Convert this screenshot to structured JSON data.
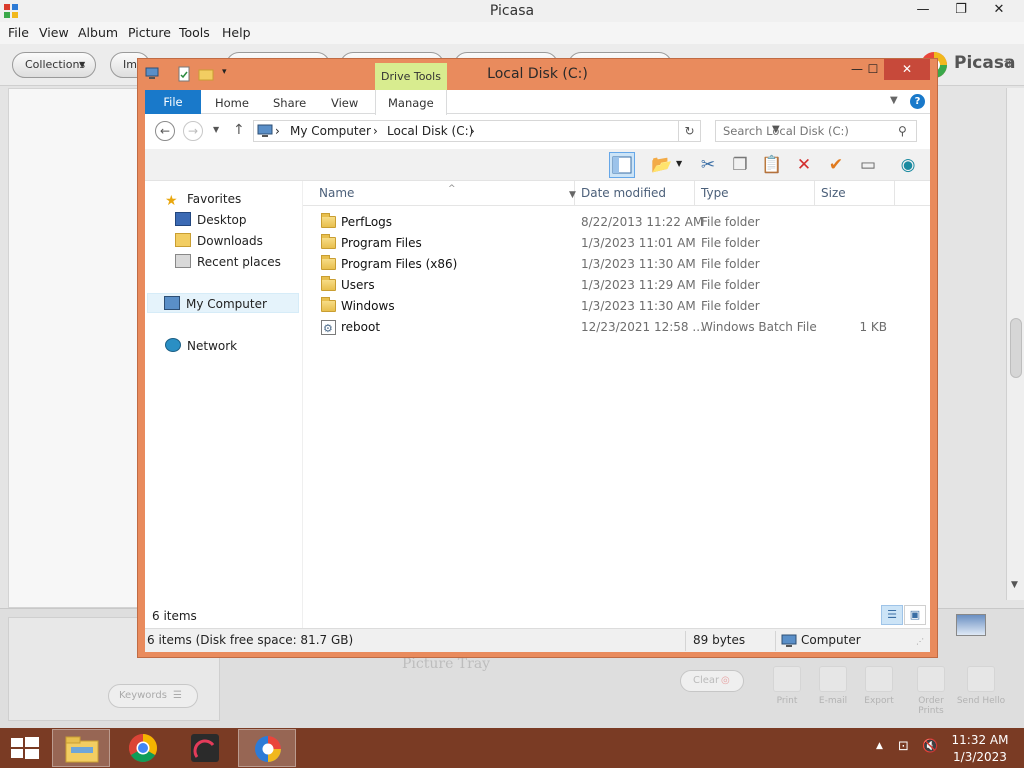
{
  "picasa": {
    "title": "Picasa",
    "menu": [
      "File",
      "View",
      "Album",
      "Picture",
      "Tools",
      "Help"
    ],
    "toolbar": {
      "collections_label": "Collections",
      "import_label": "Im"
    },
    "brand": {
      "name": "Picasa",
      "tm": "TM"
    },
    "window_controls": {
      "minimize": "—",
      "maximize": "❐",
      "close": "✕"
    },
    "bottom": {
      "keywords_label": "Keywords",
      "picture_tray_label": "Picture Tray",
      "clear_label": "Clear",
      "actions": [
        "Print",
        "E-mail",
        "Export",
        "Order Prints",
        "Send Hello"
      ]
    }
  },
  "explorer": {
    "title": "Local Disk (C:)",
    "context_tab": "Drive Tools",
    "window_controls": {
      "minimize": "—",
      "maximize": "☐",
      "close": "✕"
    },
    "ribbon_tabs": [
      "File",
      "Home",
      "Share",
      "View",
      "Manage"
    ],
    "help_label": "?",
    "address": {
      "segments": [
        "My Computer",
        "Local Disk (C:)"
      ],
      "separator": "›"
    },
    "search": {
      "placeholder": "Search Local Disk (C:)"
    },
    "navigation": {
      "favorites": "Favorites",
      "favorites_items": [
        "Desktop",
        "Downloads",
        "Recent places"
      ],
      "computer": "My Computer",
      "network": "Network"
    },
    "columns": [
      "Name",
      "Date modified",
      "Type",
      "Size"
    ],
    "files": [
      {
        "name": "PerfLogs",
        "date": "8/22/2013 11:22 AM",
        "type": "File folder",
        "size": "",
        "kind": "folder"
      },
      {
        "name": "Program Files",
        "date": "1/3/2023 11:01 AM",
        "type": "File folder",
        "size": "",
        "kind": "folder"
      },
      {
        "name": "Program Files (x86)",
        "date": "1/3/2023 11:30 AM",
        "type": "File folder",
        "size": "",
        "kind": "folder"
      },
      {
        "name": "Users",
        "date": "1/3/2023 11:29 AM",
        "type": "File folder",
        "size": "",
        "kind": "folder"
      },
      {
        "name": "Windows",
        "date": "1/3/2023 11:30 AM",
        "type": "File folder",
        "size": "",
        "kind": "folder"
      },
      {
        "name": "reboot",
        "date": "12/23/2021 12:58 ...",
        "type": "Windows Batch File",
        "size": "1 KB",
        "kind": "batch"
      }
    ],
    "item_count": "6 items",
    "status": {
      "summary": "6 items (Disk free space: 81.7 GB)",
      "size": "89 bytes",
      "location": "Computer"
    }
  },
  "taskbar": {
    "time": "11:32 AM",
    "date": "1/3/2023"
  },
  "colors": {
    "explorer_frame": "#e98b5d",
    "file_tab": "#1979ca",
    "drive_tools": "#d8ec8f",
    "taskbar": "#7a3b24"
  }
}
